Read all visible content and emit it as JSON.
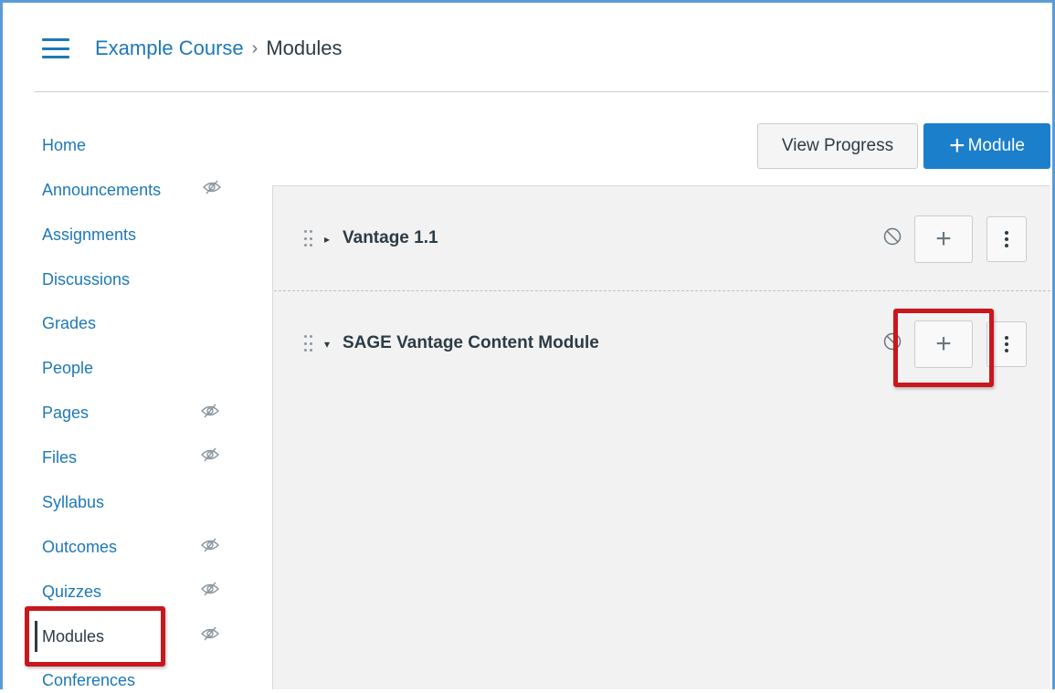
{
  "header": {
    "course_link": "Example Course",
    "separator": "›",
    "current_page": "Modules"
  },
  "sidebar": {
    "items": [
      {
        "label": "Home",
        "hidden_icon": false
      },
      {
        "label": "Announcements",
        "hidden_icon": true
      },
      {
        "label": "Assignments",
        "hidden_icon": false
      },
      {
        "label": "Discussions",
        "hidden_icon": false
      },
      {
        "label": "Grades",
        "hidden_icon": false
      },
      {
        "label": "People",
        "hidden_icon": false
      },
      {
        "label": "Pages",
        "hidden_icon": true
      },
      {
        "label": "Files",
        "hidden_icon": true
      },
      {
        "label": "Syllabus",
        "hidden_icon": false
      },
      {
        "label": "Outcomes",
        "hidden_icon": true
      },
      {
        "label": "Quizzes",
        "hidden_icon": true
      },
      {
        "label": "Modules",
        "hidden_icon": true,
        "active": true
      },
      {
        "label": "Conferences",
        "hidden_icon": false
      }
    ]
  },
  "toolbar": {
    "view_progress_label": "View Progress",
    "add_module_plus": "+",
    "add_module_label": "Module"
  },
  "modules": [
    {
      "title": "Vantage 1.1",
      "expanded": false,
      "add_label": "+"
    },
    {
      "title": "SAGE Vantage Content Module",
      "expanded": true,
      "add_label": "+"
    }
  ],
  "colors": {
    "link": "#1d78b8",
    "primary_button": "#1c7fcc",
    "highlight_box": "#c8171d",
    "panel_bg": "#f2f2f2",
    "window_border": "#5b9bd5"
  }
}
